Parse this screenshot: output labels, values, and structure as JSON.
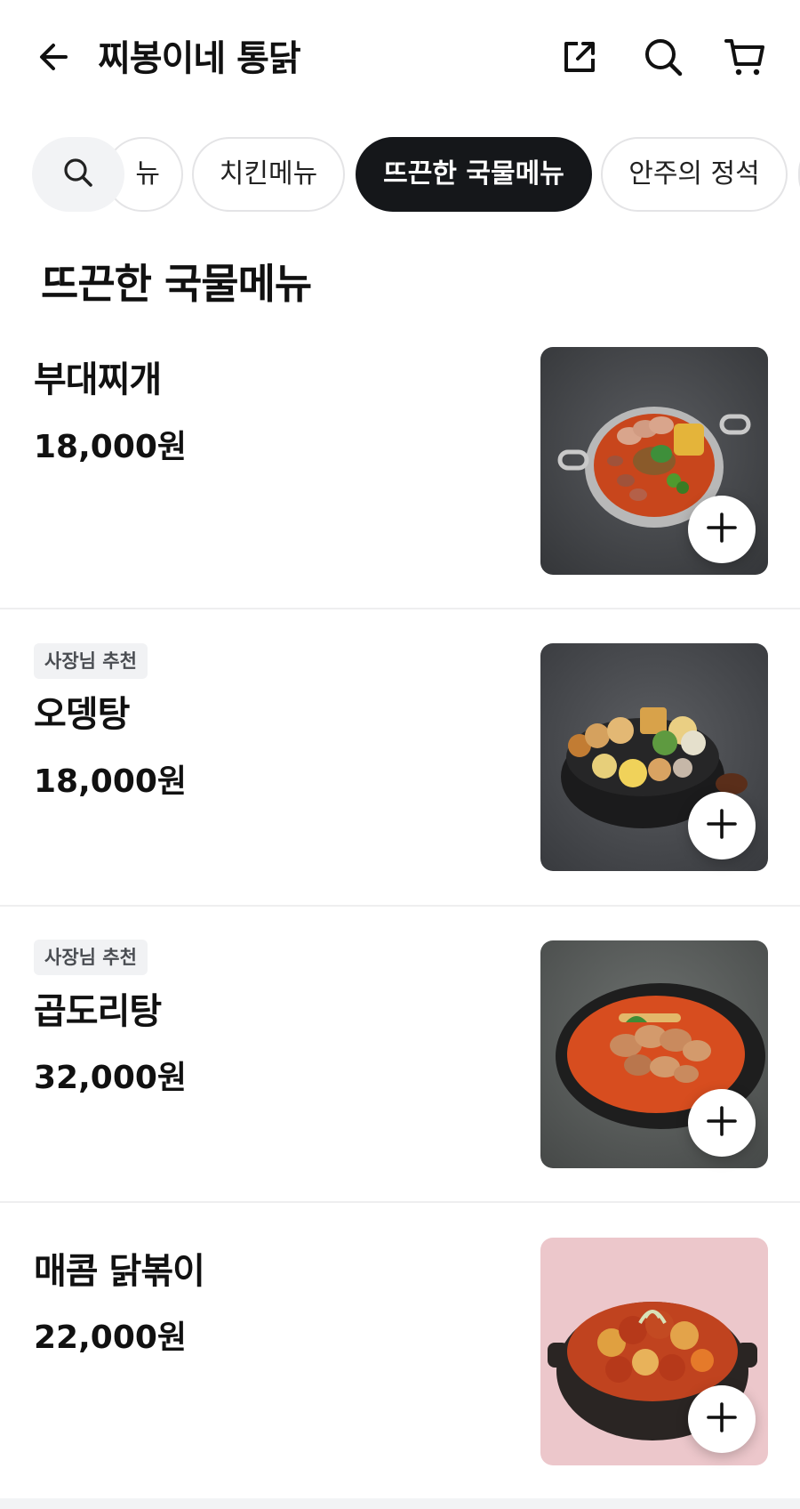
{
  "header": {
    "title": "찌봉이네 통닭",
    "back_icon": "arrow-left-icon",
    "share_icon": "share-external-icon",
    "search_icon": "search-icon",
    "cart_icon": "cart-icon"
  },
  "categories": {
    "search_icon": "search-icon",
    "items": [
      {
        "label": "뉴",
        "active": false
      },
      {
        "label": "치킨메뉴",
        "active": false
      },
      {
        "label": "뜨끈한 국물메뉴",
        "active": true
      },
      {
        "label": "안주의 정석",
        "active": false
      }
    ]
  },
  "section": {
    "title": "뜨끈한 국물메뉴"
  },
  "menu": [
    {
      "name": "부대찌개",
      "price": "18,000원",
      "badge": ""
    },
    {
      "name": "오뎅탕",
      "price": "18,000원",
      "badge": "사장님 추천"
    },
    {
      "name": "곱도리탕",
      "price": "32,000원",
      "badge": "사장님 추천"
    },
    {
      "name": "매콤 닭볶이",
      "price": "22,000원",
      "badge": ""
    }
  ],
  "colors": {
    "active_chip": "#15171a",
    "badge_bg": "#f1f2f4",
    "divider": "#eeeeef"
  },
  "add_icon": "plus-icon"
}
